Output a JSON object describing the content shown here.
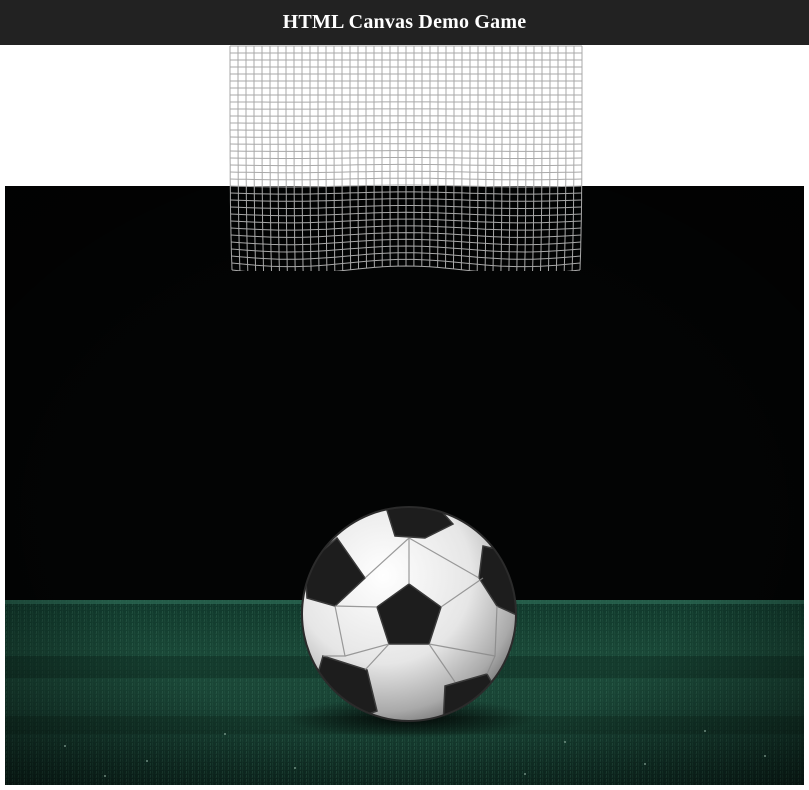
{
  "header": {
    "title": "HTML Canvas Demo Game"
  },
  "scene": {
    "background": "#000000",
    "grass_color": "#1f4d3a",
    "ball_color": "#f2f2f2",
    "net_color": "#9a9a9a",
    "ball_icon": "soccer-ball",
    "net_icon": "goal-net"
  }
}
